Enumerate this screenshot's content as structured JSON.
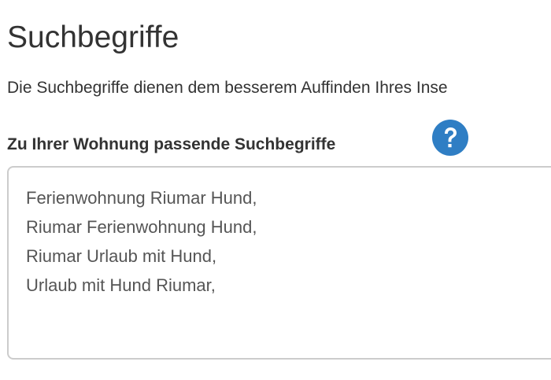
{
  "section": {
    "title": "Suchbegriffe",
    "description": "Die Suchbegriffe dienen dem besserem Auffinden Ihres Inse"
  },
  "field": {
    "label": "Zu Ihrer Wohnung passende Suchbegriffe",
    "help_icon": "question-circle-icon",
    "lines": [
      "Ferienwohnung Riumar Hund,",
      "Riumar Ferienwohnung Hund,",
      "Riumar Urlaub mit Hund,",
      "Urlaub mit Hund Riumar,"
    ]
  },
  "colors": {
    "text": "#333333",
    "help_icon_bg": "#2f7ec4",
    "textarea_border": "#cccccc",
    "textarea_text": "#555555"
  }
}
